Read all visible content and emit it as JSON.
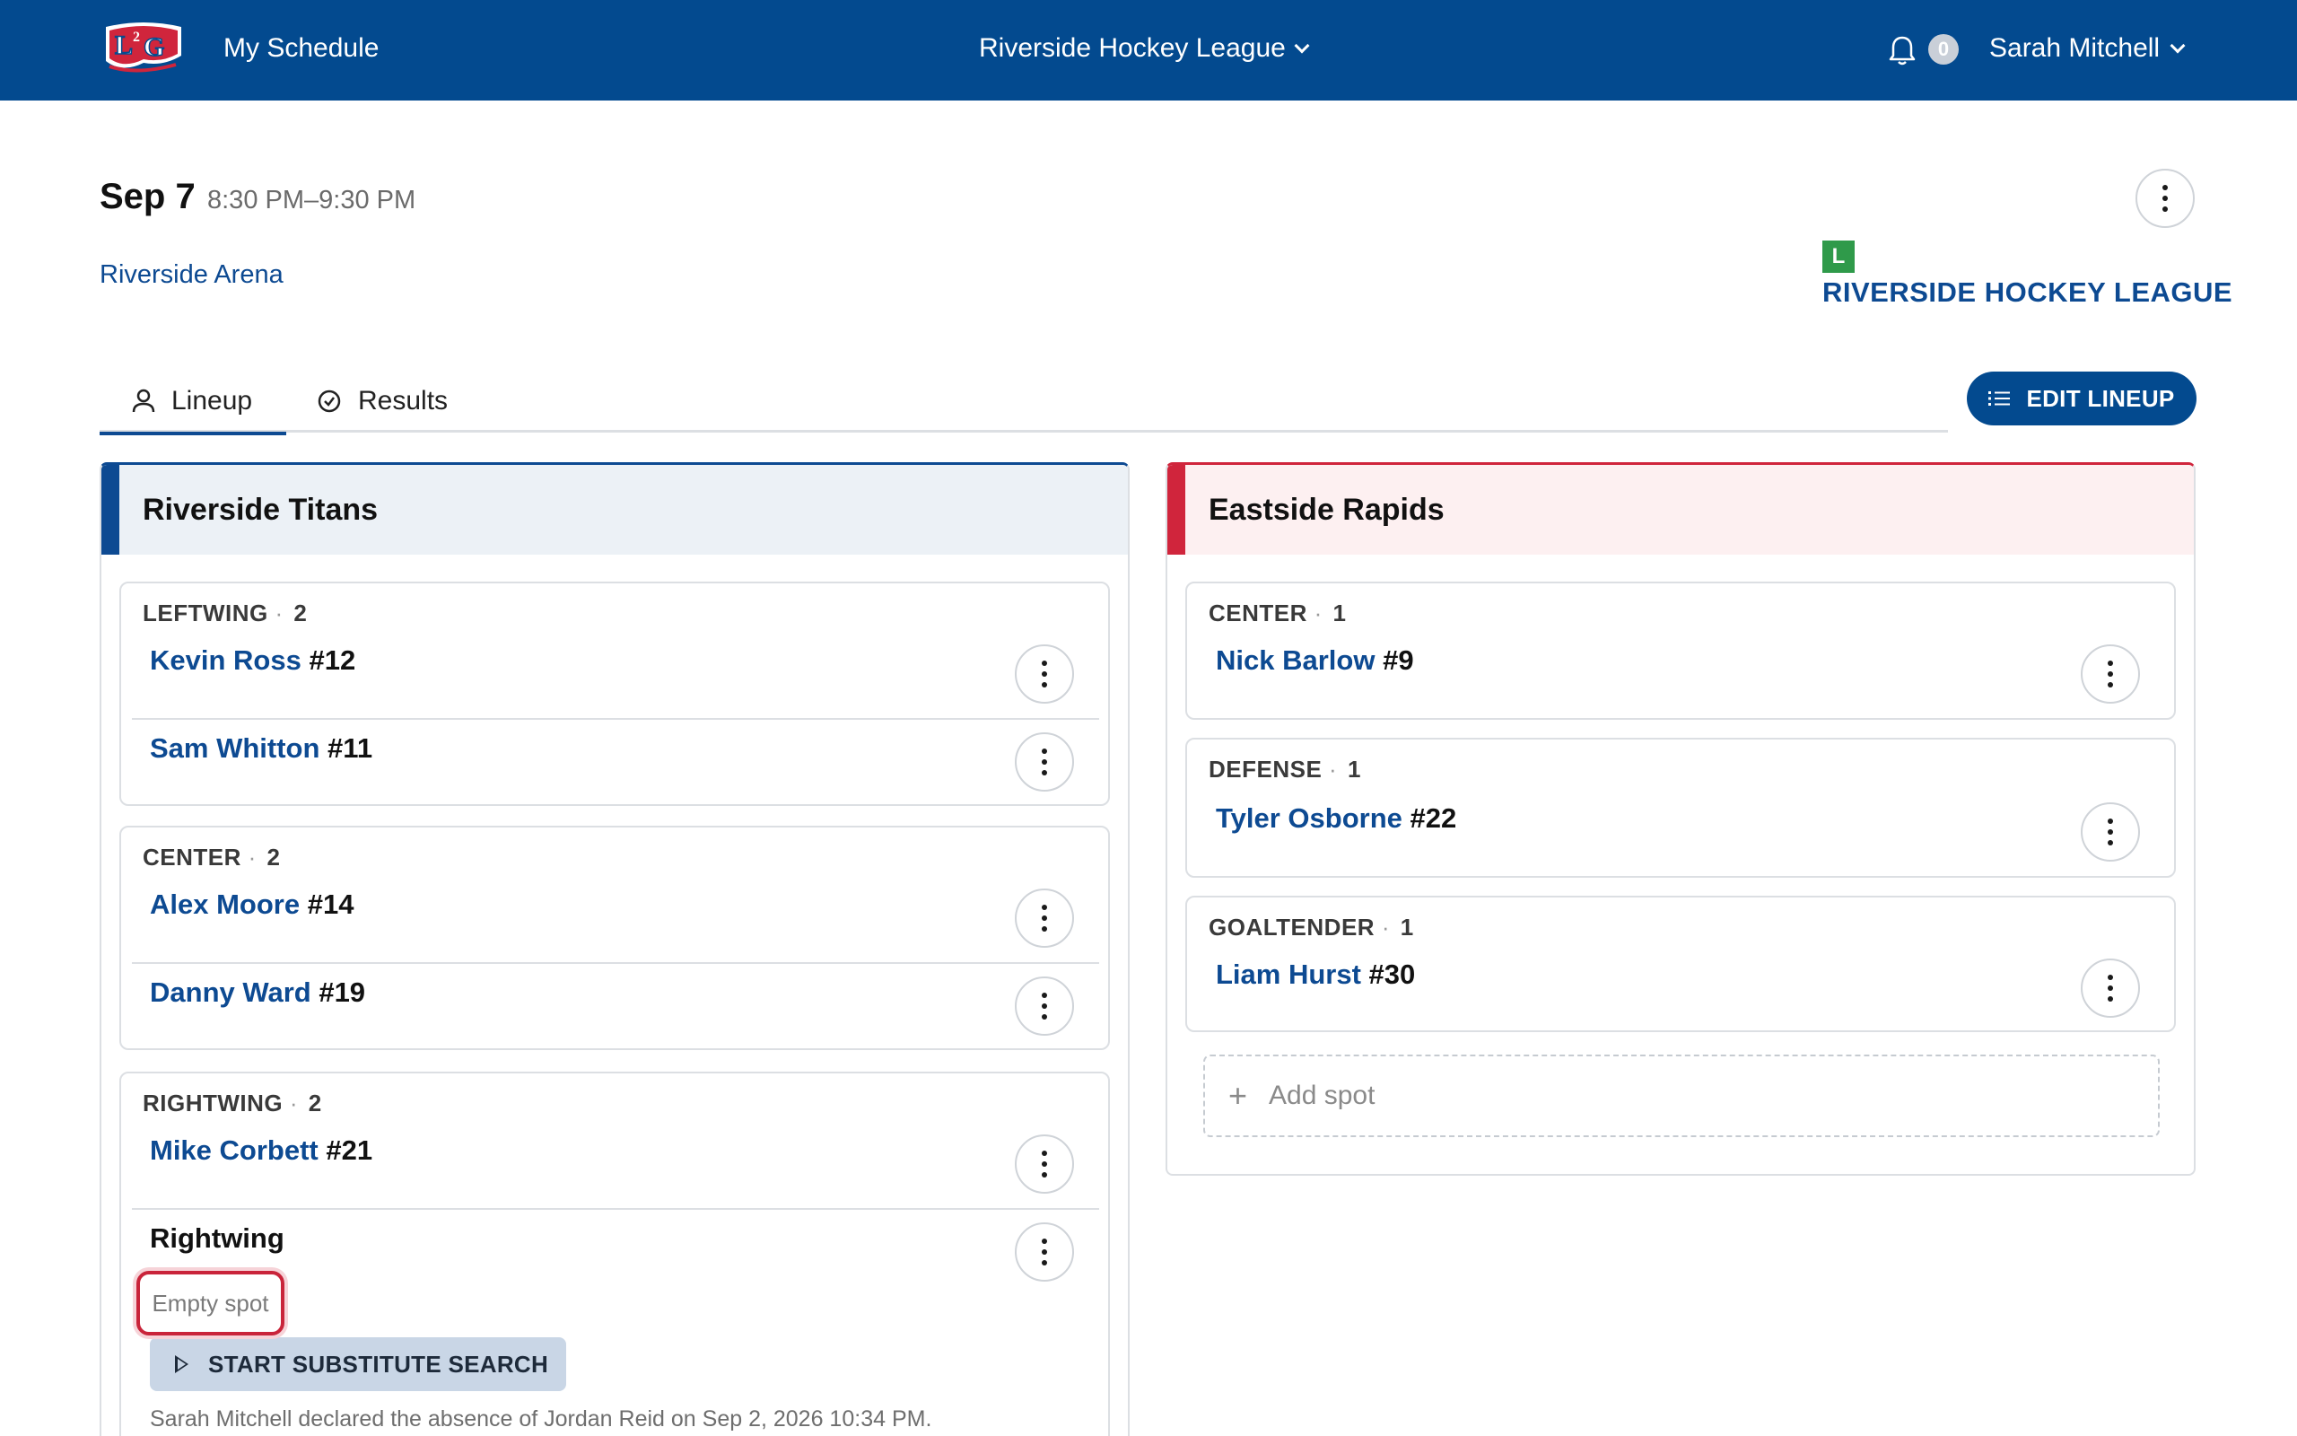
{
  "nav": {
    "logo_text": "L2G",
    "my_schedule": "My Schedule",
    "league_switcher": "Riverside Hockey League",
    "notification_count": "0",
    "user_name": "Sarah Mitchell"
  },
  "event": {
    "date": "Sep 7",
    "time": "8:30 PM–9:30 PM",
    "venue": "Riverside Arena",
    "league_badge": "L",
    "league_name": "RIVERSIDE HOCKEY LEAGUE"
  },
  "tabs": {
    "lineup": "Lineup",
    "results": "Results",
    "edit_lineup": "EDIT LINEUP"
  },
  "home_team": {
    "name": "Riverside Titans",
    "positions": [
      {
        "label": "LEFTWING",
        "sep": "·",
        "count": "2",
        "players": [
          {
            "name": "Kevin Ross",
            "number": "#12"
          },
          {
            "name": "Sam Whitton",
            "number": "#11"
          }
        ]
      },
      {
        "label": "CENTER",
        "sep": "·",
        "count": "2",
        "players": [
          {
            "name": "Alex Moore",
            "number": "#14"
          },
          {
            "name": "Danny Ward",
            "number": "#19"
          }
        ]
      },
      {
        "label": "RIGHTWING",
        "sep": "·",
        "count": "2",
        "players": [
          {
            "name": "Mike Corbett",
            "number": "#21"
          }
        ],
        "empty_slot": {
          "title": "Rightwing",
          "status": "Empty spot",
          "action": "START SUBSTITUTE SEARCH",
          "note": "Sarah Mitchell declared the absence of Jordan Reid on Sep 2, 2026 10:34 PM."
        }
      }
    ]
  },
  "away_team": {
    "name": "Eastside Rapids",
    "positions": [
      {
        "label": "CENTER",
        "sep": "·",
        "count": "1",
        "players": [
          {
            "name": "Nick Barlow",
            "number": "#9"
          }
        ]
      },
      {
        "label": "DEFENSE",
        "sep": "·",
        "count": "1",
        "players": [
          {
            "name": "Tyler Osborne",
            "number": "#22"
          }
        ]
      },
      {
        "label": "GOALTENDER",
        "sep": "·",
        "count": "1",
        "players": [
          {
            "name": "Liam Hurst",
            "number": "#30"
          }
        ]
      }
    ],
    "add_spot": "Add spot"
  },
  "colors": {
    "brand_blue": "#034a8f",
    "link_blue": "#0d4a92",
    "away_red": "#d0253c",
    "league_green": "#2f9a4a"
  }
}
